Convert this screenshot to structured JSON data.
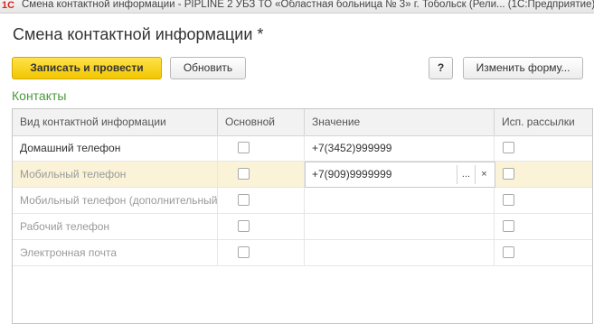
{
  "window": {
    "logo": "1С",
    "title": "Смена контактной информации - PIPLINE 2 УБЗ ТО «Областная больница № 3» г. Тобольск (Рели...  (1С:Предприятие)"
  },
  "form": {
    "title": "Смена контактной информации *"
  },
  "toolbar": {
    "post_label": "Записать и провести",
    "refresh_label": "Обновить",
    "help_label": "?",
    "customize_label": "Изменить форму..."
  },
  "contacts": {
    "group_title": "Контакты",
    "columns": [
      "Вид контактной информации",
      "Основной",
      "Значение",
      "Исп. рассылки"
    ],
    "rows": [
      {
        "type": "Домашний телефон",
        "main": false,
        "value": "+7(3452)999999",
        "mailing": false
      },
      {
        "type": "Мобильный телефон",
        "main": false,
        "value": "+7(909)9999999",
        "mailing": false
      },
      {
        "type": "Мобильный телефон (дополнительный)",
        "main": false,
        "value": "",
        "mailing": false
      },
      {
        "type": "Рабочий телефон",
        "main": false,
        "value": "",
        "mailing": false
      },
      {
        "type": "Электронная почта",
        "main": false,
        "value": "",
        "mailing": false
      }
    ],
    "editor": {
      "select_label": "...",
      "clear_label": "×"
    }
  },
  "colors": {
    "accent_yellow": "#f2c600",
    "group_title_green": "#4a9a3a",
    "selected_row": "#faf3d8"
  }
}
